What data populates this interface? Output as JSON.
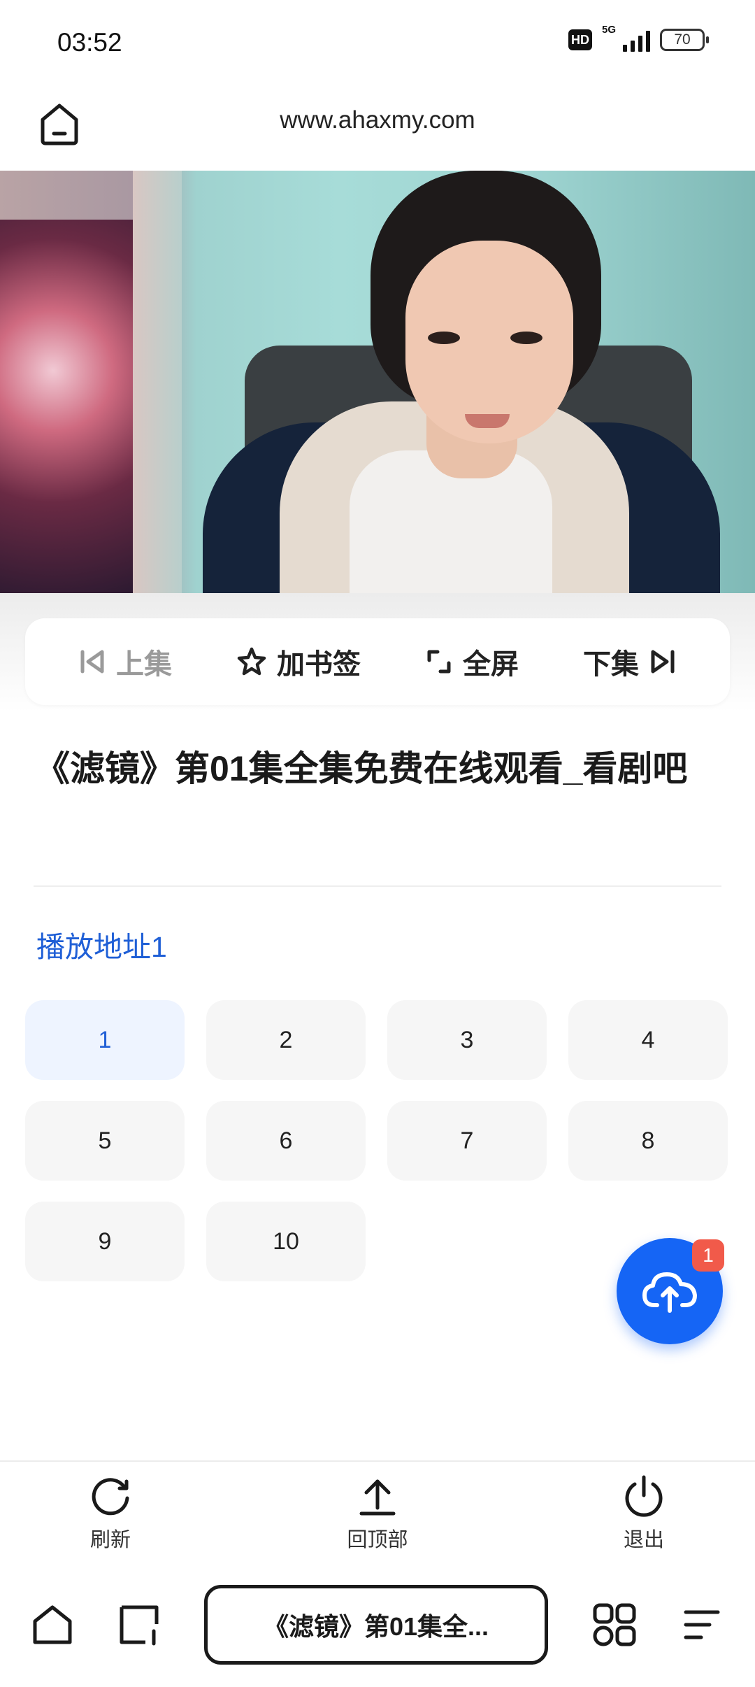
{
  "status_bar": {
    "time": "03:52",
    "hd": "HD",
    "network": "5G",
    "battery": "70"
  },
  "browser": {
    "url": "www.ahaxmy.com"
  },
  "controls": {
    "prev": "上集",
    "bookmark": "加书签",
    "fullscreen": "全屏",
    "next": "下集"
  },
  "page_title": "《滤镜》第01集全集免费在线观看_看剧吧",
  "source": {
    "label": "播放地址1"
  },
  "episodes": [
    "1",
    "2",
    "3",
    "4",
    "5",
    "6",
    "7",
    "8",
    "9",
    "10"
  ],
  "active_episode": "1",
  "upload_badge": "1",
  "actions": {
    "refresh": "刷新",
    "top": "回顶部",
    "exit": "退出"
  },
  "nav": {
    "tab_title": "《滤镜》第01集全..."
  },
  "colors": {
    "accent": "#1565f5",
    "link": "#1f5fd6",
    "badge": "#f15a4a",
    "active_bg": "#eef4ff"
  }
}
